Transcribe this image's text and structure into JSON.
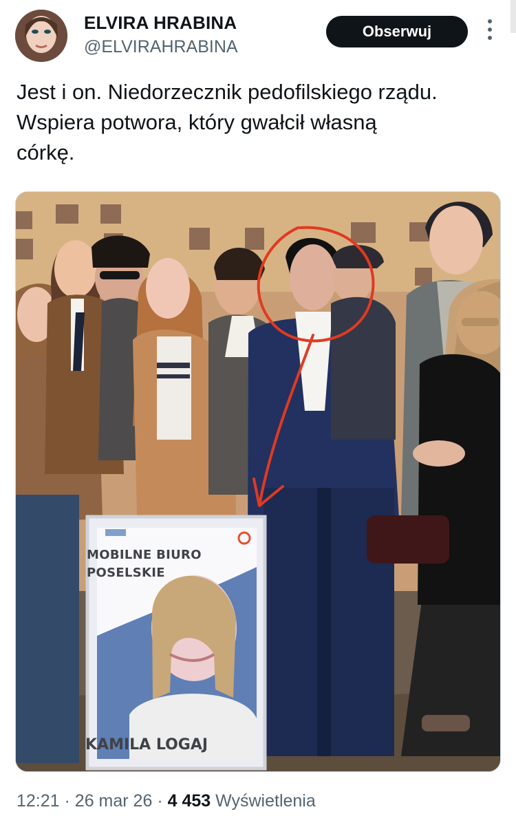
{
  "header": {
    "display_name": "ELVIRA HRABINA",
    "handle": "@ELVIRAHRABINA",
    "follow_label": "Obserwuj",
    "more_icon": "more-vertical-icon"
  },
  "tweet": {
    "text_lines": [
      "Jest i on. Niedorzecznik pedofilskiego rządu.",
      "Wspiera potwora, który gwałcił własną",
      "córkę."
    ]
  },
  "media": {
    "poster_title": "MOBILNE BIURO\nPOSELSKIE",
    "poster_name": "KAMILA LOGAJ",
    "annotation_color": "#e03a22"
  },
  "footer": {
    "time": "12:21",
    "separator": "·",
    "date": "26 mar 26",
    "views_count": "4 453",
    "views_label": "Wyświetlenia"
  },
  "colors": {
    "text": "#0f1419",
    "muted": "#536471",
    "button_bg": "#0f1419",
    "button_text": "#ffffff"
  }
}
